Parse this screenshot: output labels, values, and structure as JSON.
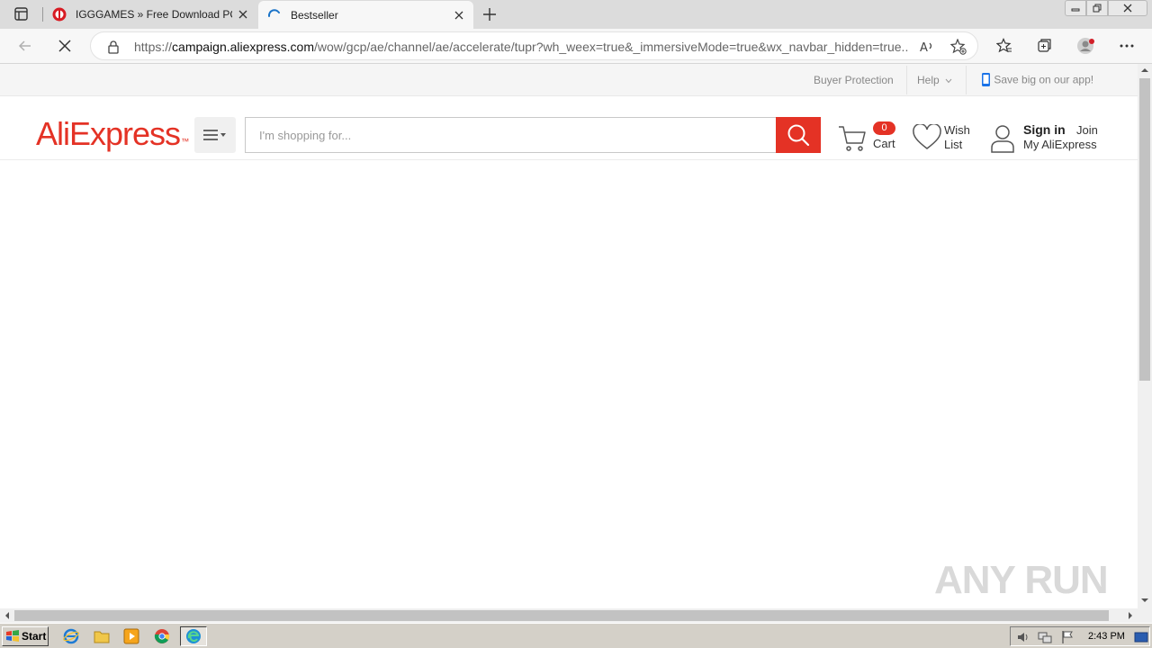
{
  "browser": {
    "tabs": [
      {
        "title": "IGGGAMES » Free Download PC G",
        "active": false
      },
      {
        "title": "Bestseller",
        "active": true
      }
    ],
    "url_prefix": "https://",
    "url_host": "campaign.aliexpress.com",
    "url_rest": "/wow/gcp/ae/channel/ae/accelerate/tupr?wh_weex=true&_immersiveMode=true&wx_navbar_hidden=true..."
  },
  "page": {
    "topbar": {
      "buyer_protection": "Buyer Protection",
      "help": "Help",
      "app_promo": "Save big on our app!"
    },
    "header": {
      "logo": "AliExpress",
      "search_placeholder": "I'm shopping for...",
      "cart_count": "0",
      "cart_label": "Cart",
      "wish_label": "Wish List",
      "sign_in": "Sign in",
      "join": "Join",
      "my_account": "My AliExpress"
    },
    "watermark": "ANY RUN"
  },
  "taskbar": {
    "start_label": "Start",
    "clock": "2:43 PM"
  },
  "colors": {
    "brand": "#e43225",
    "tab_strip": "#dcdcdc",
    "taskbar": "#d4d0c8"
  }
}
